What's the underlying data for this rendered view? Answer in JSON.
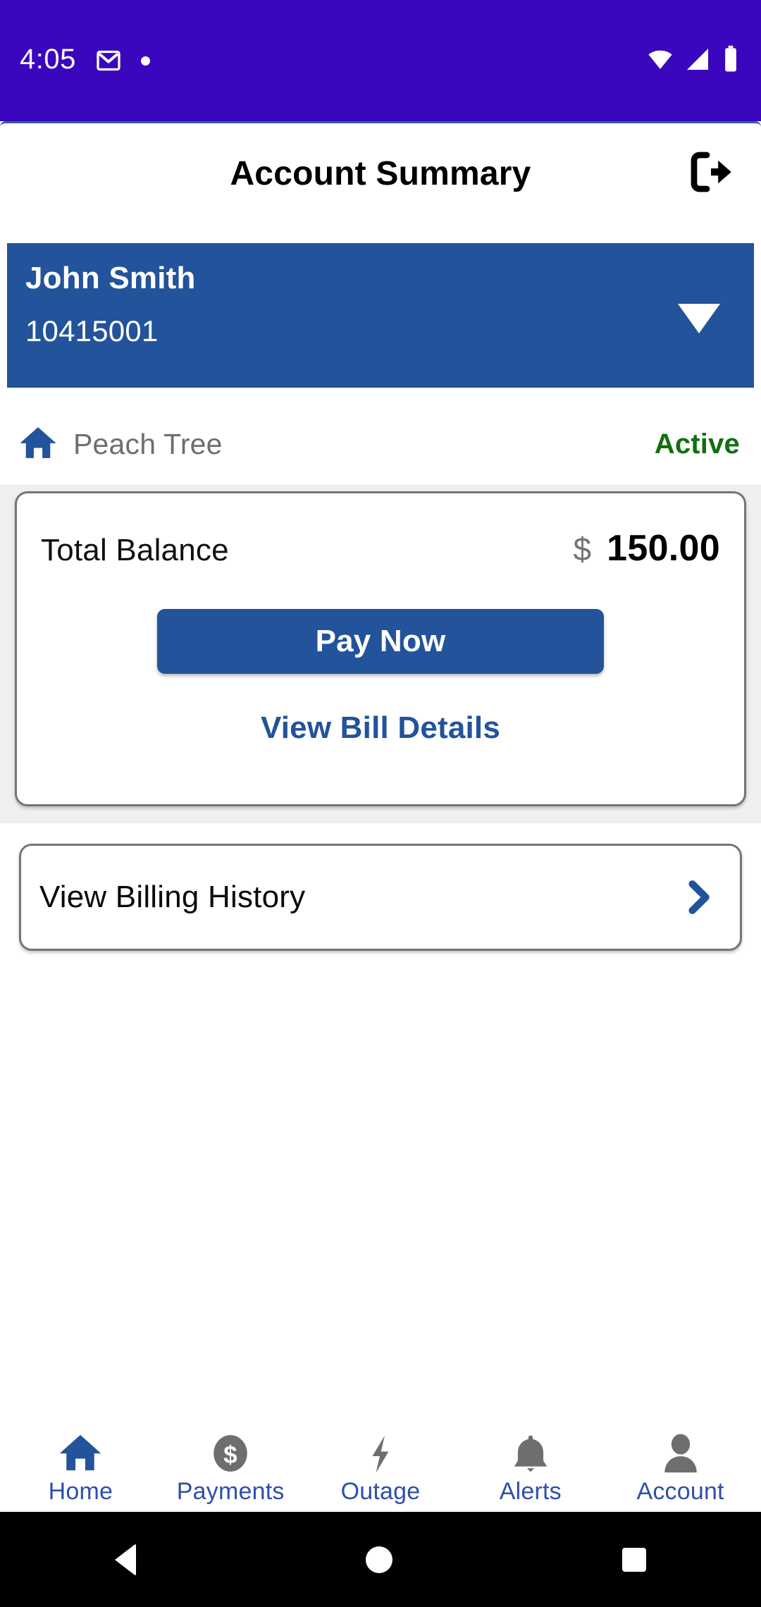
{
  "status_bar": {
    "time": "4:05",
    "icons": [
      "gmail-icon",
      "notification-dot",
      "wifi-icon",
      "cellular-signal-icon",
      "battery-icon"
    ],
    "background_color": "#3A07BE"
  },
  "header": {
    "title": "Account Summary",
    "logout_icon": "logout-icon"
  },
  "account_selector": {
    "name": "John Smith",
    "number": "10415001",
    "caret_icon": "chevron-down-icon",
    "background_color": "#22539B"
  },
  "premise": {
    "home_icon": "home-icon",
    "label": "Peach Tree",
    "status": "Active",
    "status_color": "#107010"
  },
  "balance_card": {
    "label": "Total Balance",
    "currency": "$",
    "amount": "150.00",
    "pay_now_label": "Pay Now",
    "view_bill_label": "View Bill Details",
    "accent_color": "#22539B"
  },
  "billing_history": {
    "label": "View Billing History",
    "chevron_icon": "chevron-right-icon"
  },
  "bottom_nav": {
    "items": [
      {
        "label": "Home",
        "icon": "home-icon",
        "active": true
      },
      {
        "label": "Payments",
        "icon": "dollar-circle-icon",
        "active": false
      },
      {
        "label": "Outage",
        "icon": "lightning-bolt-icon",
        "active": false
      },
      {
        "label": "Alerts",
        "icon": "bell-icon",
        "active": false
      },
      {
        "label": "Account",
        "icon": "person-icon",
        "active": false
      }
    ],
    "active_color": "#22539B",
    "inactive_color": "#6E6E6E",
    "label_color": "#2F4FA8"
  },
  "android_nav": {
    "back_icon": "triangle-back-icon",
    "home_icon": "circle-home-icon",
    "recents_icon": "square-recents-icon"
  }
}
